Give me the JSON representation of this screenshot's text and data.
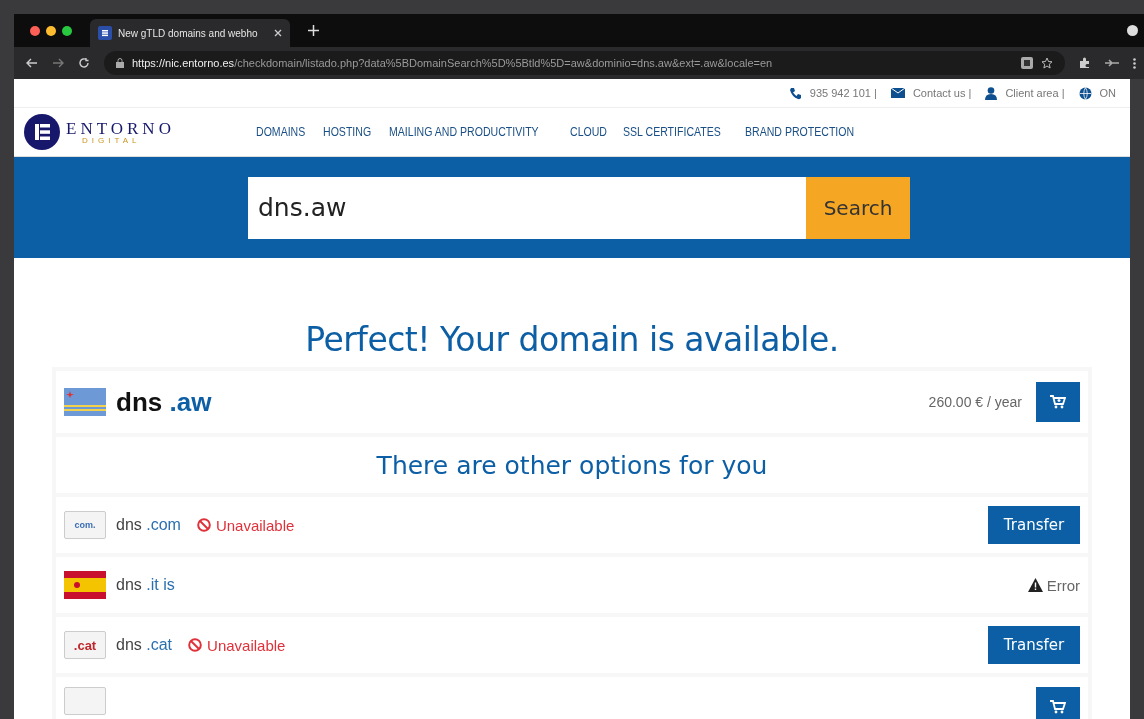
{
  "browser": {
    "tab_title": "New gTLD domains and webho",
    "url_host": "https://nic.entorno.es",
    "url_path": "/checkdomain/listado.php?data%5BDomainSearch%5D%5Btld%5D=aw&dominio=dns.aw&ext=.aw&locale=en"
  },
  "topbar": [
    {
      "kind": "phone",
      "label": "935 942 101 |"
    },
    {
      "kind": "mail",
      "label": "Contact us |"
    },
    {
      "kind": "user",
      "label": "Client area |"
    },
    {
      "kind": "globe",
      "label": "ON"
    }
  ],
  "logo": {
    "name": "ENTORNO",
    "tagline": "DIGITAL"
  },
  "nav": [
    "DOMAINS",
    "HOSTING",
    "MAILING AND PRODUCTIVITY",
    "CLOUD",
    "SSL CERTIFICATES",
    "BRAND PROTECTION"
  ],
  "search": {
    "value": "dns.aw",
    "button": "Search"
  },
  "headline": "Perfect! Your domain is available.",
  "main_result": {
    "name": "dns",
    "ext": ".aw",
    "price": "260.00 € / year"
  },
  "other_heading": "There are other options for you",
  "options": [
    {
      "badge": {
        "kind": "com",
        "text": "com."
      },
      "name": "dns",
      "ext": ".com",
      "status": {
        "kind": "unavailable",
        "text": "Unavailable"
      },
      "action": "Transfer"
    },
    {
      "badge": {
        "kind": "flag"
      },
      "name": "dns",
      "ext": ".it is",
      "status": {
        "kind": "error",
        "text": "Error"
      }
    },
    {
      "badge": {
        "kind": "cat",
        "text": ".cat"
      },
      "name": "dns",
      "ext": ".cat",
      "status": {
        "kind": "unavailable",
        "text": "Unavailable"
      },
      "action": "Transfer"
    },
    {
      "badge": {
        "kind": "blank"
      },
      "status": {
        "kind": "cart"
      }
    }
  ]
}
